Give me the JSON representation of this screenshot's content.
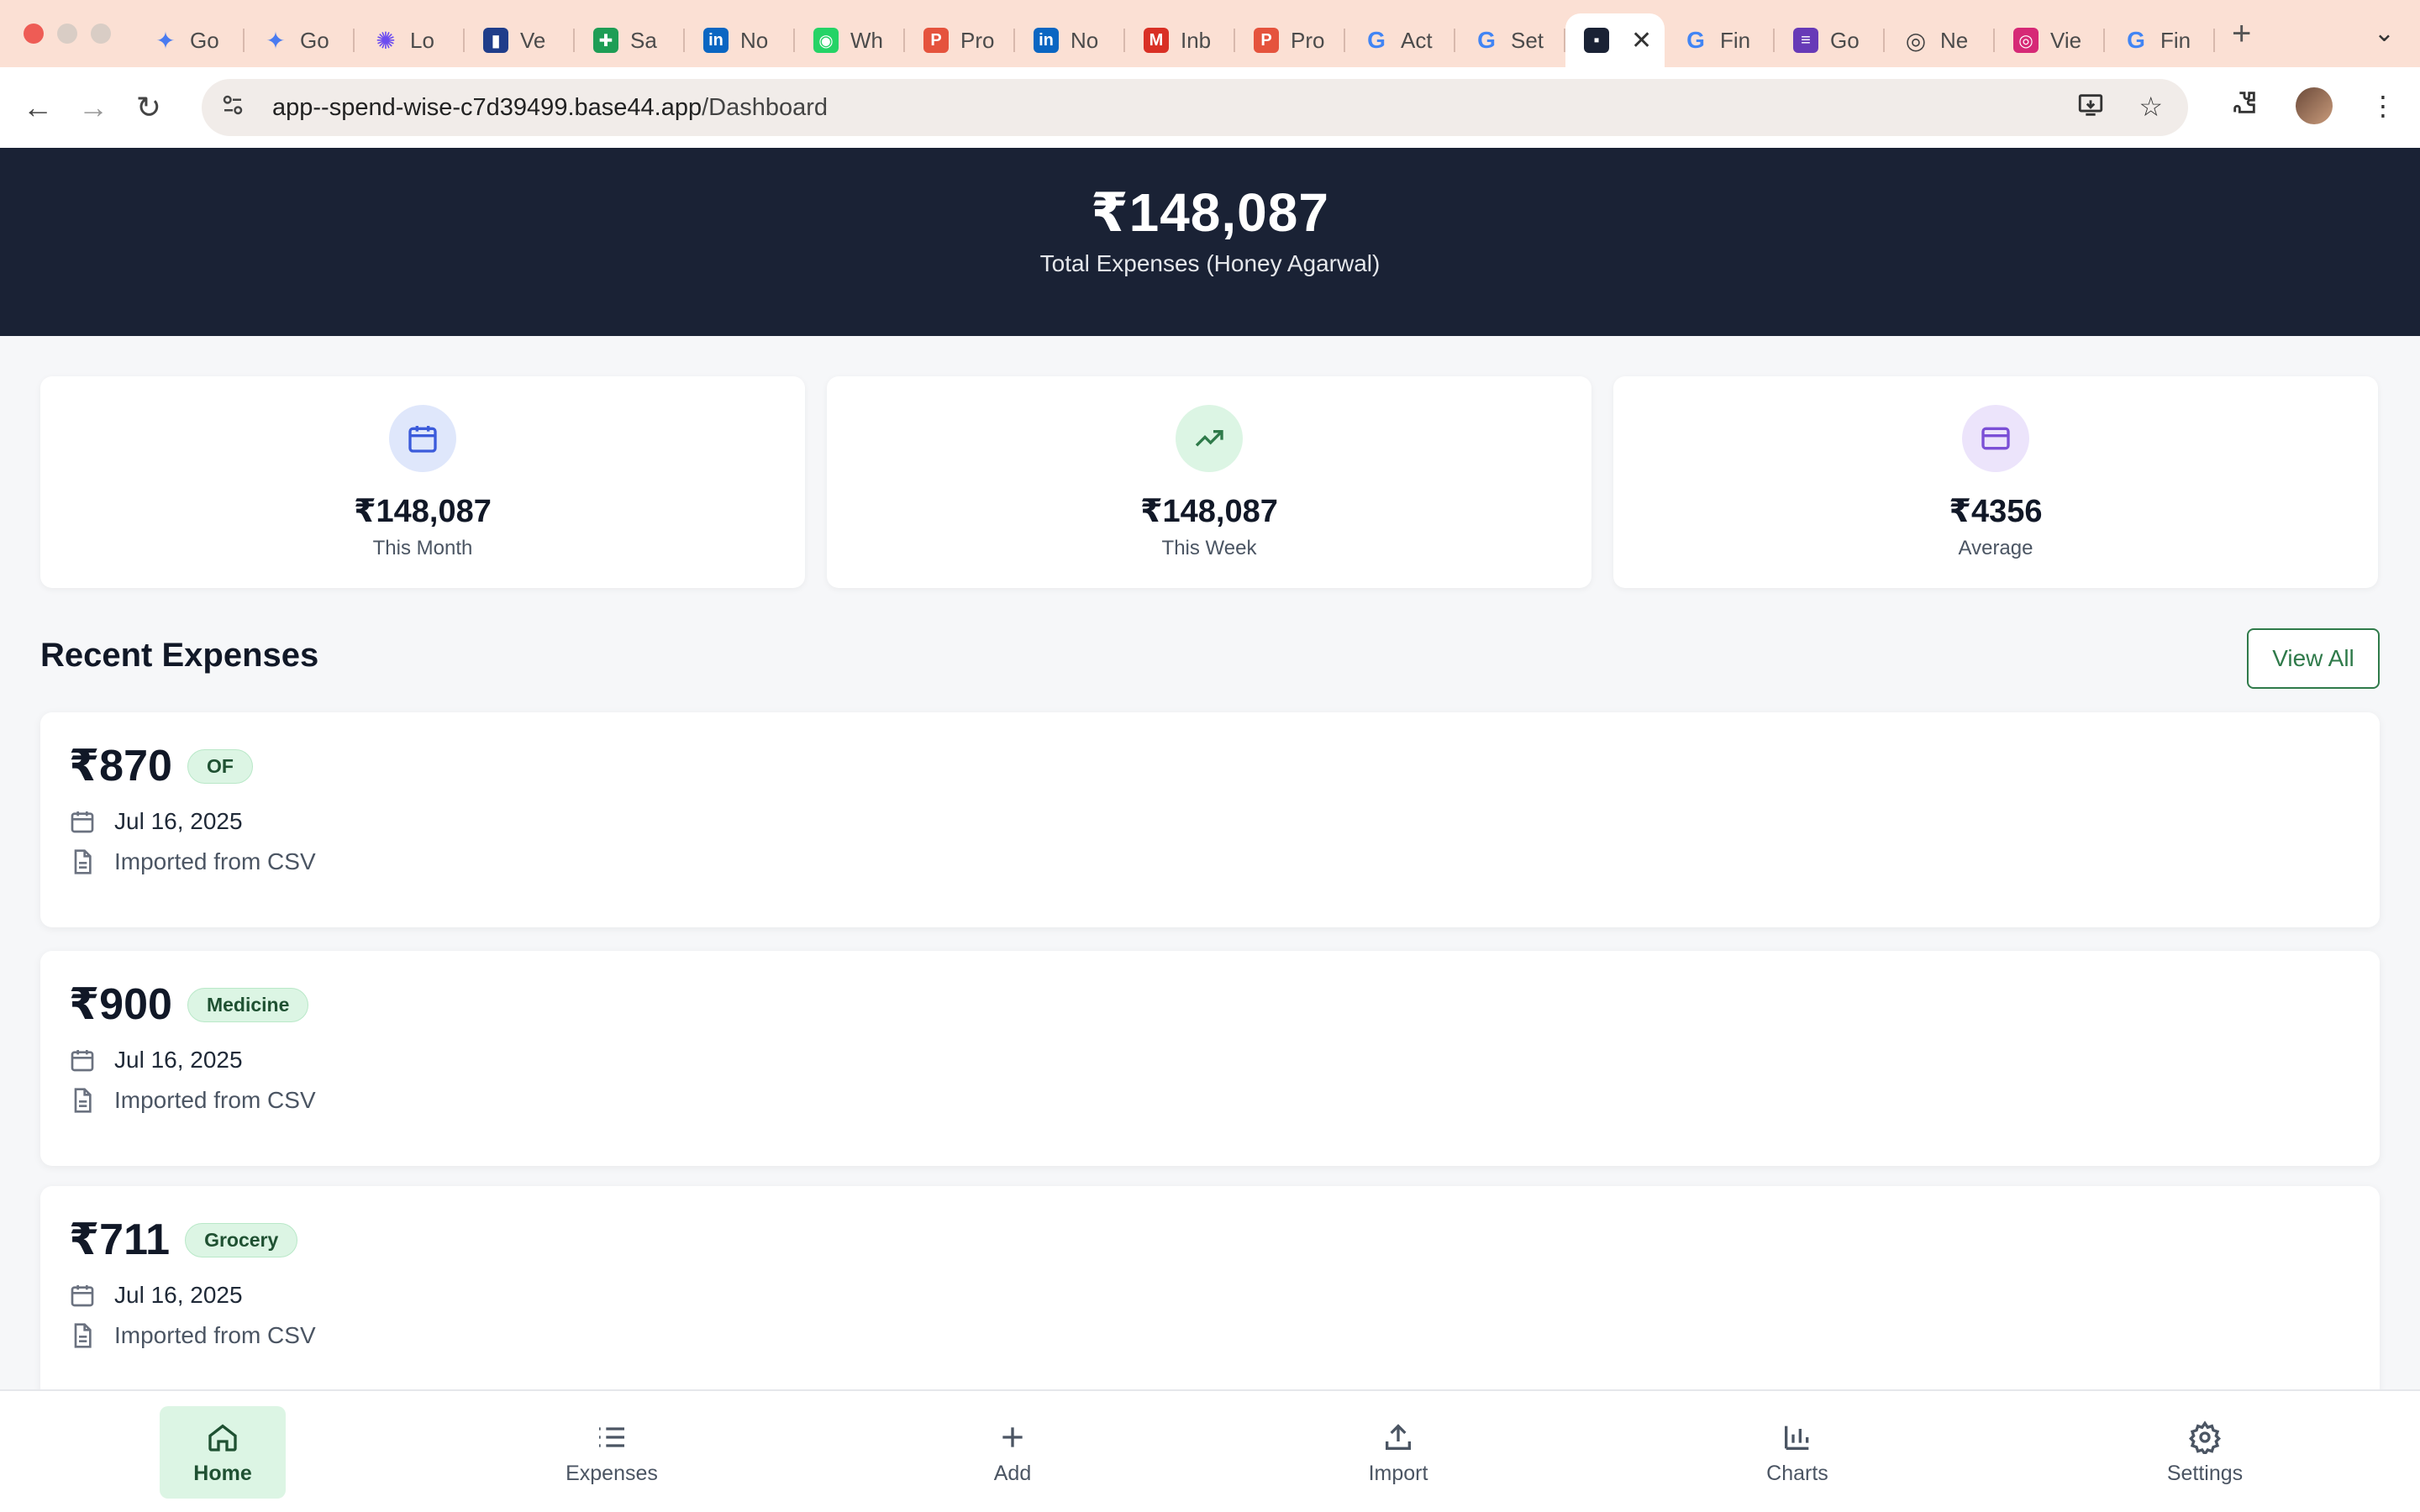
{
  "browser": {
    "tabs": [
      {
        "title": "Go",
        "favicon": "gemini-star",
        "color": "#4a7bf0"
      },
      {
        "title": "Go",
        "favicon": "gemini-star",
        "color": "#4a7bf0"
      },
      {
        "title": "Lo",
        "favicon": "lovable-flower",
        "color": "#6c4cf0"
      },
      {
        "title": "Ve",
        "favicon": "vercel-doc",
        "color": "#1f3d8a"
      },
      {
        "title": "Sa",
        "favicon": "sheets-plus",
        "color": "#1e9d55"
      },
      {
        "title": "No",
        "favicon": "linkedin-in",
        "color": "#0a66c2"
      },
      {
        "title": "Wh",
        "favicon": "whatsapp",
        "color": "#25d366"
      },
      {
        "title": "Pro",
        "favicon": "p-circle",
        "color": "#e5533d"
      },
      {
        "title": "No",
        "favicon": "linkedin-in",
        "color": "#0a66c2"
      },
      {
        "title": "Inb",
        "favicon": "gmail",
        "color": "#d93025"
      },
      {
        "title": "Pro",
        "favicon": "p-circle",
        "color": "#e5533d"
      },
      {
        "title": "Act",
        "favicon": "google-g",
        "color": "#4285f4"
      },
      {
        "title": "Set",
        "favicon": "google-g",
        "color": "#4285f4"
      },
      {
        "title": "",
        "favicon": "app-square",
        "color": "#1a2235",
        "active": true
      },
      {
        "title": "Fin",
        "favicon": "google-g",
        "color": "#4285f4"
      },
      {
        "title": "Go",
        "favicon": "forms-list",
        "color": "#673ab7"
      },
      {
        "title": "Ne",
        "favicon": "chrome",
        "color": "#444444"
      },
      {
        "title": "Vie",
        "favicon": "instagram",
        "color": "#d62976"
      },
      {
        "title": "Fin",
        "favicon": "google-g",
        "color": "#4285f4"
      }
    ],
    "url_host": "app--spend-wise-c7d39499.base44.app",
    "url_path": "/Dashboard"
  },
  "hero": {
    "amount": "₹148,087",
    "label": "Total Expenses (Honey Agarwal)"
  },
  "stats": [
    {
      "icon": "calendar-icon",
      "value": "₹148,087",
      "label": "This Month",
      "bg": "#dfe7fb",
      "fg": "#3b5bdb"
    },
    {
      "icon": "trending-up-icon",
      "value": "₹148,087",
      "label": "This Week",
      "bg": "#dcf5e4",
      "fg": "#2f7a4a"
    },
    {
      "icon": "card-icon",
      "value": "₹4356",
      "label": "Average",
      "bg": "#ece4fb",
      "fg": "#7b4fd6"
    }
  ],
  "recent": {
    "title": "Recent Expenses",
    "view_all": "View All",
    "items": [
      {
        "amount": "₹870",
        "tag": "OF",
        "date": "Jul 16, 2025",
        "note": "Imported from CSV"
      },
      {
        "amount": "₹900",
        "tag": "Medicine",
        "date": "Jul 16, 2025",
        "note": "Imported from CSV"
      },
      {
        "amount": "₹711",
        "tag": "Grocery",
        "date": "Jul 16, 2025",
        "note": "Imported from CSV"
      }
    ]
  },
  "nav": [
    {
      "label": "Home",
      "icon": "home-icon",
      "active": true
    },
    {
      "label": "Expenses",
      "icon": "list-icon"
    },
    {
      "label": "Add",
      "icon": "plus-icon"
    },
    {
      "label": "Import",
      "icon": "upload-icon"
    },
    {
      "label": "Charts",
      "icon": "bar-chart-icon"
    },
    {
      "label": "Settings",
      "icon": "gear-icon"
    }
  ],
  "colors": {
    "hero_bg": "#1a2235",
    "accent_green": "#2f7a4a",
    "tag_bg": "#dcf5e4"
  }
}
